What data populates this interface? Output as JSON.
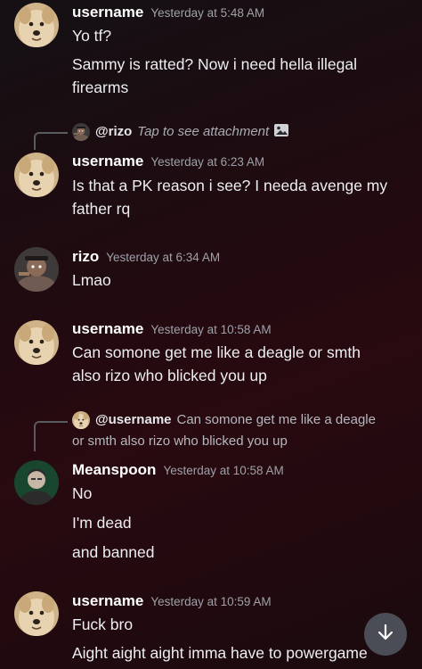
{
  "messages": [
    {
      "author": "username",
      "timestamp": "Yesterday at 5:48 AM",
      "avatar": "dog-avatar",
      "lines": [
        "Yo tf?",
        "Sammy is ratted? Now i need hella illegal",
        "firearms"
      ]
    },
    {
      "reply": {
        "author": "@rizo",
        "hint": "Tap to see attachment",
        "icon": "image-icon"
      },
      "author": "username",
      "timestamp": "Yesterday at 6:23 AM",
      "avatar": "dog-avatar",
      "lines": [
        "Is that a PK reason i see? I needa avenge my",
        "father rq"
      ]
    },
    {
      "author": "rizo",
      "timestamp": "Yesterday at 6:34 AM",
      "avatar": "rizo-avatar",
      "lines": [
        "Lmao"
      ]
    },
    {
      "author": "username",
      "timestamp": "Yesterday at 10:58 AM",
      "avatar": "dog-avatar",
      "lines": [
        "Can somone get me like a deagle or smth",
        "also rizo who blicked you up"
      ]
    },
    {
      "reply": {
        "author": "@username",
        "text_line1": "Can somone get me like a deagle",
        "text_line2": "or smth also rizo who blicked you up"
      },
      "author": "Meanspoon",
      "timestamp": "Yesterday at 10:58 AM",
      "avatar": "meanspoon-avatar",
      "lines": [
        "No",
        "I'm dead",
        "and banned"
      ]
    },
    {
      "author": "username",
      "timestamp": "Yesterday at 10:59 AM",
      "avatar": "dog-avatar",
      "lines": [
        "Fuck bro",
        "Aight aight aight imma have to powergame"
      ]
    }
  ],
  "scroll_button": {
    "icon": "arrow-down-icon",
    "bg": "#4a4d55"
  },
  "colors": {
    "text": "#eceef1",
    "muted": "#9fa1a8",
    "reply_line": "#5a5b60"
  }
}
